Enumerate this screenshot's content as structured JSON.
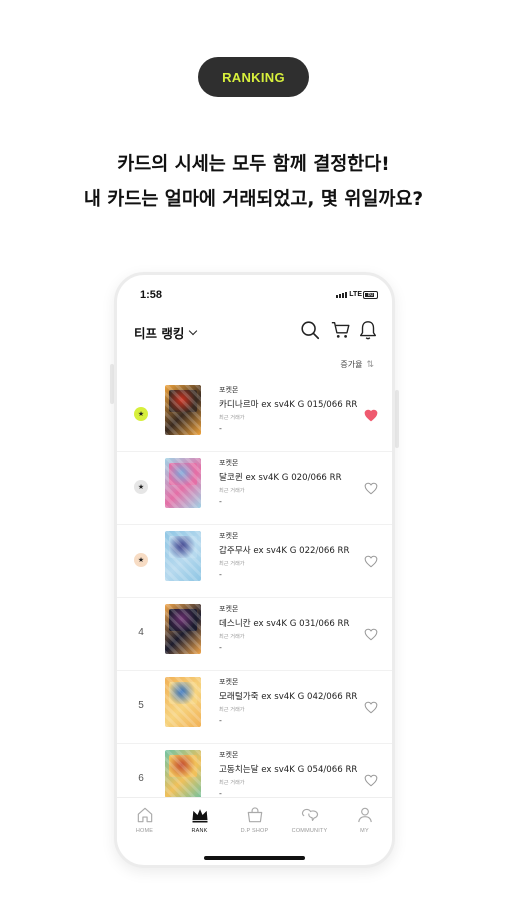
{
  "badge": "RANKING",
  "headline": {
    "line1": "카드의 시세는 모두 함께 결정한다!",
    "line2": "내 카드는 얼마에 거래되었고, 몇 위일까요?"
  },
  "phone": {
    "status": {
      "time": "1:58",
      "network": "LTE",
      "battery": "80"
    },
    "title": "티프 랭킹",
    "sort_label": "증가율",
    "items": [
      {
        "rank": "",
        "category": "포켓몬",
        "name": "카디나르마 ex sv4K G 015/066 RR",
        "sub": "최근 거래가",
        "price": "-",
        "liked": true,
        "colors": [
          "#f0a43c",
          "#c8301e",
          "#3a2a20"
        ]
      },
      {
        "rank": "",
        "category": "포켓몬",
        "name": "달코퀸 ex sv4K G 020/066 RR",
        "sub": "최근 거래가",
        "price": "-",
        "liked": false,
        "colors": [
          "#9fd3e6",
          "#7aa7d8",
          "#e46fa6"
        ]
      },
      {
        "rank": "",
        "category": "포켓몬",
        "name": "갑주무사 ex sv4K G 022/066 RR",
        "sub": "최근 거래가",
        "price": "-",
        "liked": false,
        "colors": [
          "#8fc6e4",
          "#3c3f8c",
          "#b6d9ee"
        ]
      },
      {
        "rank": "4",
        "category": "포켓몬",
        "name": "데스니칸 ex sv4K G 031/066 RR",
        "sub": "최근 거래가",
        "price": "-",
        "liked": false,
        "colors": [
          "#f2a64a",
          "#6a2e6e",
          "#1c1c2e"
        ]
      },
      {
        "rank": "5",
        "category": "포켓몬",
        "name": "모래털가죽 ex sv4K G 042/066 RR",
        "sub": "최근 거래가",
        "price": "-",
        "liked": false,
        "colors": [
          "#f1b156",
          "#2f6fbf",
          "#f6d37e"
        ]
      },
      {
        "rank": "6",
        "category": "포켓몬",
        "name": "고동치는달 ex sv4K G 054/066 RR",
        "sub": "최근 거래가",
        "price": "-",
        "liked": false,
        "colors": [
          "#6fc2a2",
          "#c34a2c",
          "#f0c05a"
        ]
      }
    ],
    "rank_badge_colors": [
      "#d7ef3c",
      "#e6e6e6",
      "#f7dcc4"
    ],
    "accent": "#ef5a6f",
    "tabs": [
      {
        "label": "HOME",
        "icon": "home-icon",
        "active": false
      },
      {
        "label": "RANK",
        "icon": "crown-icon",
        "active": true
      },
      {
        "label": "D.P SHOP",
        "icon": "shopping-bag-icon",
        "active": false
      },
      {
        "label": "COMMUNITY",
        "icon": "chat-bubbles-icon",
        "active": false
      },
      {
        "label": "MY",
        "icon": "person-icon",
        "active": false
      }
    ]
  }
}
